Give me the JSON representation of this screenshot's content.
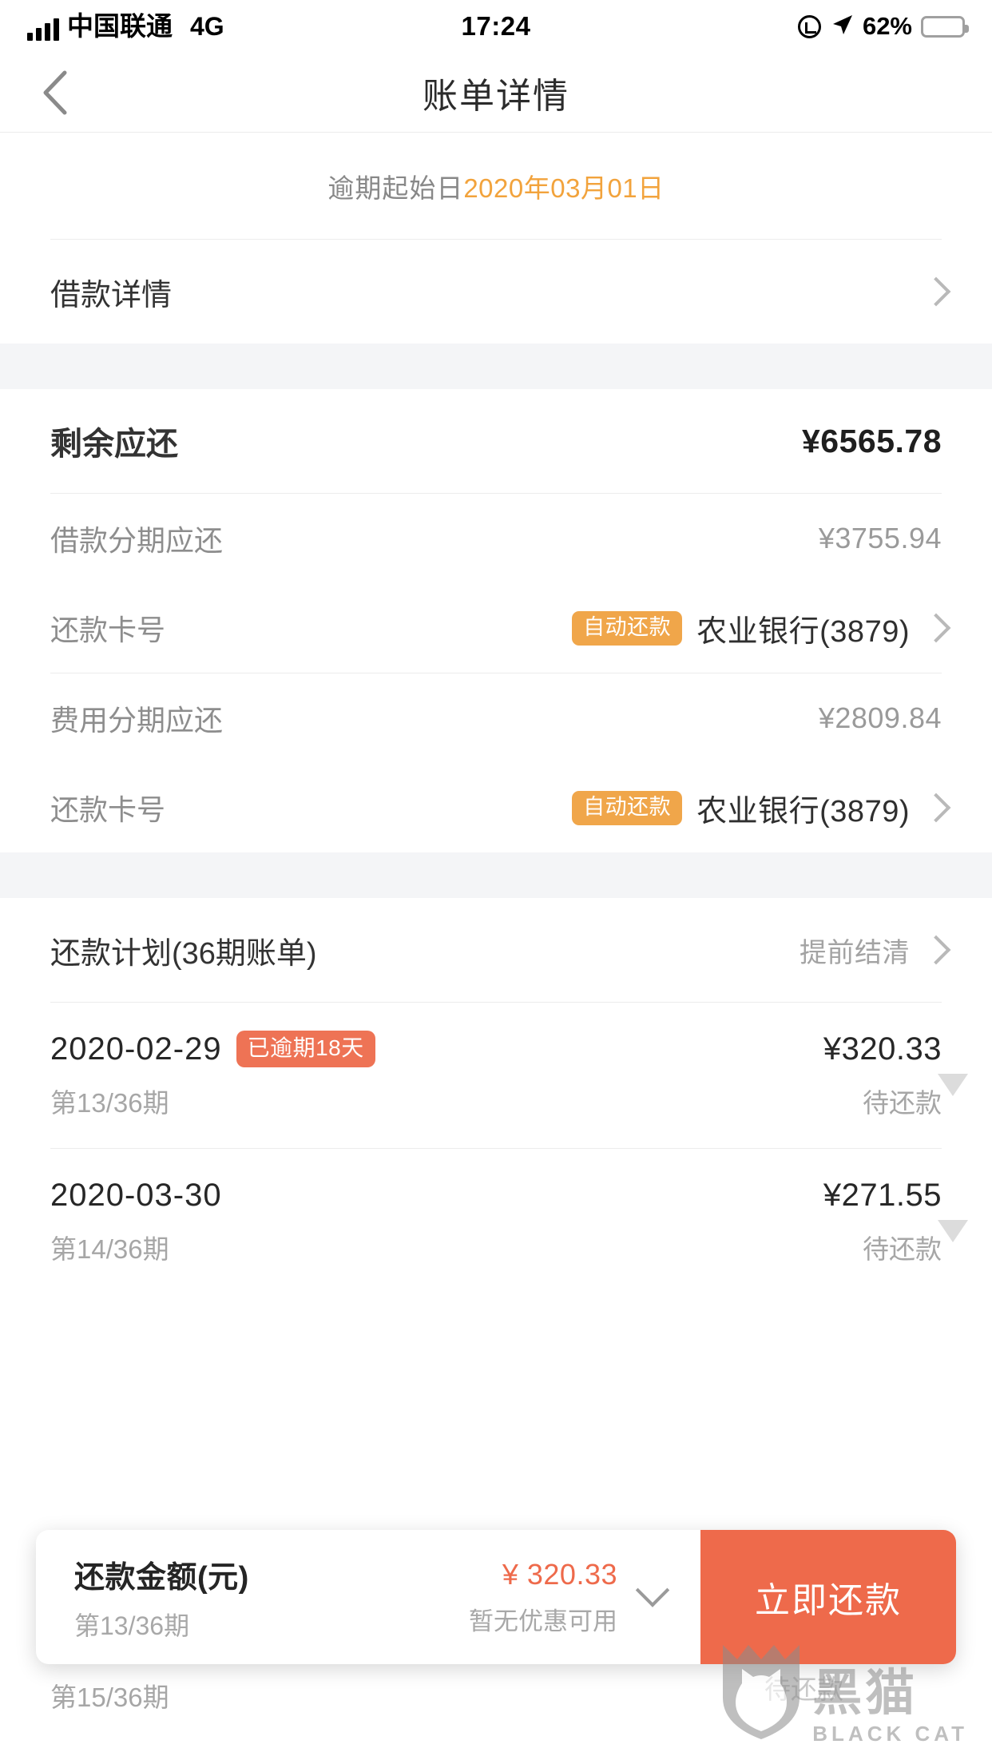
{
  "status_bar": {
    "carrier": "中国联通",
    "network": "4G",
    "time": "17:24",
    "battery_percent": "62%",
    "icons": [
      "signal-bars-icon",
      "rotation-lock-icon",
      "location-arrow-icon",
      "battery-icon"
    ]
  },
  "nav": {
    "title": "账单详情",
    "back_icon": "chevron-left-icon"
  },
  "overdue_banner": {
    "label": "逾期起始日",
    "date": "2020年03月01日",
    "date_color": "#F2A33C"
  },
  "loan_detail_row": {
    "label": "借款详情",
    "chevron": "chevron-right-icon"
  },
  "summary": {
    "remaining": {
      "label": "剩余应还",
      "value": "¥6565.78"
    },
    "principal": {
      "label": "借款分期应还",
      "value": "¥3755.94"
    },
    "principal_card": {
      "label": "还款卡号",
      "badge": "自动还款",
      "bank": "农业银行(3879)",
      "chevron": "chevron-right-icon"
    },
    "fee": {
      "label": "费用分期应还",
      "value": "¥2809.84"
    },
    "fee_card": {
      "label": "还款卡号",
      "badge": "自动还款",
      "bank": "农业银行(3879)",
      "chevron": "chevron-right-icon"
    }
  },
  "plan_header": {
    "title": "还款计划(36期账单)",
    "action": "提前结清",
    "chevron": "chevron-right-icon"
  },
  "plan_rows": [
    {
      "date": "2020-02-29",
      "badge": "已逾期18天",
      "amount": "¥320.33",
      "term": "第13/36期",
      "status": "待还款"
    },
    {
      "date": "2020-03-30",
      "badge": "",
      "amount": "¥271.55",
      "term": "第14/36期",
      "status": "待还款"
    }
  ],
  "peek_row": {
    "term": "第15/36期",
    "status": "待还款"
  },
  "pay_bar": {
    "title": "还款金额(元)",
    "term": "第13/36期",
    "amount": "¥ 320.33",
    "coupon_note": "暂无优惠可用",
    "caret_icon": "chevron-down-icon",
    "button_label": "立即还款",
    "accent_color": "#EE6A4B"
  },
  "watermark": {
    "cn": "黑猫",
    "en": "BLACK CAT",
    "icon": "cat-shield-icon"
  },
  "colors": {
    "orange_badge": "#F0A64A",
    "red_badge": "#EE7355",
    "accent": "#EE6A4B",
    "band": "#f4f5f7"
  }
}
